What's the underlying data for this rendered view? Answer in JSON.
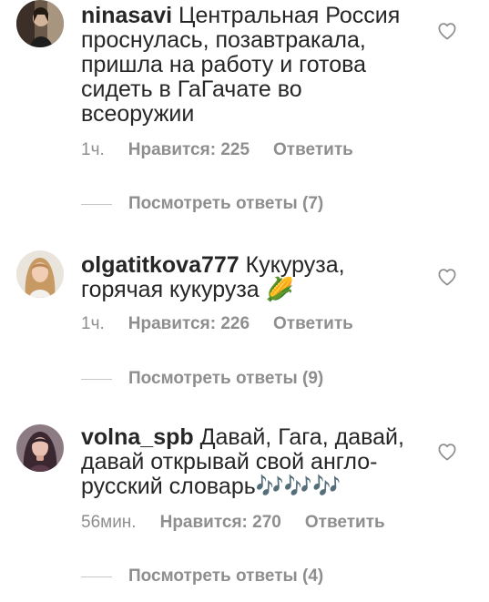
{
  "comments": [
    {
      "username": "ninasavi",
      "text": " Центральная Россия\nпроснулась, позавтракала,\nпришла на работу и готова\nсидеть в ГаГачате во\nвсеоружии",
      "time": "1ч.",
      "likes": "Нравится: 225",
      "reply": "Ответить",
      "view_replies": "Посмотреть ответы (7)",
      "avatar_icon": "avatar-photo"
    },
    {
      "username": "olgatitkova777",
      "text": " Кукуруза,\nгорячая кукуруза 🌽",
      "time": "1ч.",
      "likes": "Нравится: 226",
      "reply": "Ответить",
      "view_replies": "Посмотреть ответы (9)",
      "avatar_icon": "avatar-photo"
    },
    {
      "username": "volna_spb",
      "text": " Давай, Гага, давай,\nдавай открывай свой англо-\nрусский словарь🎶🎶🎶",
      "time": "56мин.",
      "likes": "Нравится: 270",
      "reply": "Ответить",
      "view_replies": "Посмотреть ответы (4)",
      "avatar_icon": "avatar-photo"
    }
  ],
  "colors": {
    "text": "#262626",
    "secondary": "#8e8e8e",
    "divider": "#c7c7c7"
  },
  "icons": {
    "like": "heart-outline-icon"
  }
}
